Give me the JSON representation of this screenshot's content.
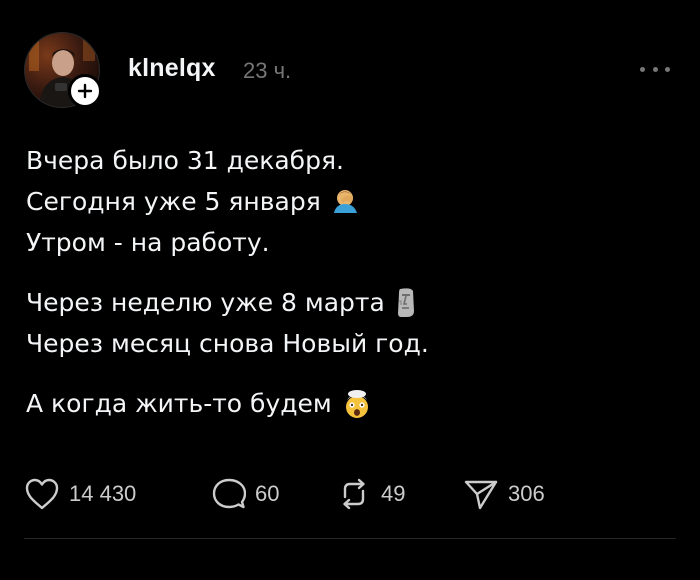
{
  "post": {
    "username": "klnelqx",
    "timestamp": "23 ч.",
    "lines": [
      "Вчера было 31 декабря.",
      "Сегодня уже 5 января",
      "Утром - на работу.",
      "Через неделю уже 8 марта",
      "Через месяц снова Новый год.",
      "А когда жить-то будем"
    ],
    "emojis": {
      "line2": "facepalm-emoji",
      "line4": "moai-emoji",
      "line6": "exploding-head-emoji"
    }
  },
  "actions": {
    "likes": "14 430",
    "replies": "60",
    "reposts": "49",
    "shares": "306"
  },
  "colors": {
    "background": "#000000",
    "text": "#f3f5f7",
    "muted": "#777777",
    "icon": "#cccccc"
  }
}
